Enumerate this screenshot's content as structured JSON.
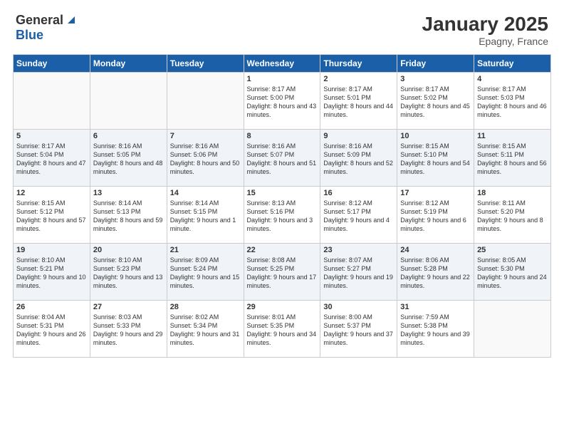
{
  "header": {
    "logo_general": "General",
    "logo_blue": "Blue",
    "month_year": "January 2025",
    "location": "Epagny, France"
  },
  "weekdays": [
    "Sunday",
    "Monday",
    "Tuesday",
    "Wednesday",
    "Thursday",
    "Friday",
    "Saturday"
  ],
  "weeks": [
    [
      {
        "day": "",
        "sunrise": "",
        "sunset": "",
        "daylight": ""
      },
      {
        "day": "",
        "sunrise": "",
        "sunset": "",
        "daylight": ""
      },
      {
        "day": "",
        "sunrise": "",
        "sunset": "",
        "daylight": ""
      },
      {
        "day": "1",
        "sunrise": "Sunrise: 8:17 AM",
        "sunset": "Sunset: 5:00 PM",
        "daylight": "Daylight: 8 hours and 43 minutes."
      },
      {
        "day": "2",
        "sunrise": "Sunrise: 8:17 AM",
        "sunset": "Sunset: 5:01 PM",
        "daylight": "Daylight: 8 hours and 44 minutes."
      },
      {
        "day": "3",
        "sunrise": "Sunrise: 8:17 AM",
        "sunset": "Sunset: 5:02 PM",
        "daylight": "Daylight: 8 hours and 45 minutes."
      },
      {
        "day": "4",
        "sunrise": "Sunrise: 8:17 AM",
        "sunset": "Sunset: 5:03 PM",
        "daylight": "Daylight: 8 hours and 46 minutes."
      }
    ],
    [
      {
        "day": "5",
        "sunrise": "Sunrise: 8:17 AM",
        "sunset": "Sunset: 5:04 PM",
        "daylight": "Daylight: 8 hours and 47 minutes."
      },
      {
        "day": "6",
        "sunrise": "Sunrise: 8:16 AM",
        "sunset": "Sunset: 5:05 PM",
        "daylight": "Daylight: 8 hours and 48 minutes."
      },
      {
        "day": "7",
        "sunrise": "Sunrise: 8:16 AM",
        "sunset": "Sunset: 5:06 PM",
        "daylight": "Daylight: 8 hours and 50 minutes."
      },
      {
        "day": "8",
        "sunrise": "Sunrise: 8:16 AM",
        "sunset": "Sunset: 5:07 PM",
        "daylight": "Daylight: 8 hours and 51 minutes."
      },
      {
        "day": "9",
        "sunrise": "Sunrise: 8:16 AM",
        "sunset": "Sunset: 5:09 PM",
        "daylight": "Daylight: 8 hours and 52 minutes."
      },
      {
        "day": "10",
        "sunrise": "Sunrise: 8:15 AM",
        "sunset": "Sunset: 5:10 PM",
        "daylight": "Daylight: 8 hours and 54 minutes."
      },
      {
        "day": "11",
        "sunrise": "Sunrise: 8:15 AM",
        "sunset": "Sunset: 5:11 PM",
        "daylight": "Daylight: 8 hours and 56 minutes."
      }
    ],
    [
      {
        "day": "12",
        "sunrise": "Sunrise: 8:15 AM",
        "sunset": "Sunset: 5:12 PM",
        "daylight": "Daylight: 8 hours and 57 minutes."
      },
      {
        "day": "13",
        "sunrise": "Sunrise: 8:14 AM",
        "sunset": "Sunset: 5:13 PM",
        "daylight": "Daylight: 8 hours and 59 minutes."
      },
      {
        "day": "14",
        "sunrise": "Sunrise: 8:14 AM",
        "sunset": "Sunset: 5:15 PM",
        "daylight": "Daylight: 9 hours and 1 minute."
      },
      {
        "day": "15",
        "sunrise": "Sunrise: 8:13 AM",
        "sunset": "Sunset: 5:16 PM",
        "daylight": "Daylight: 9 hours and 3 minutes."
      },
      {
        "day": "16",
        "sunrise": "Sunrise: 8:12 AM",
        "sunset": "Sunset: 5:17 PM",
        "daylight": "Daylight: 9 hours and 4 minutes."
      },
      {
        "day": "17",
        "sunrise": "Sunrise: 8:12 AM",
        "sunset": "Sunset: 5:19 PM",
        "daylight": "Daylight: 9 hours and 6 minutes."
      },
      {
        "day": "18",
        "sunrise": "Sunrise: 8:11 AM",
        "sunset": "Sunset: 5:20 PM",
        "daylight": "Daylight: 9 hours and 8 minutes."
      }
    ],
    [
      {
        "day": "19",
        "sunrise": "Sunrise: 8:10 AM",
        "sunset": "Sunset: 5:21 PM",
        "daylight": "Daylight: 9 hours and 10 minutes."
      },
      {
        "day": "20",
        "sunrise": "Sunrise: 8:10 AM",
        "sunset": "Sunset: 5:23 PM",
        "daylight": "Daylight: 9 hours and 13 minutes."
      },
      {
        "day": "21",
        "sunrise": "Sunrise: 8:09 AM",
        "sunset": "Sunset: 5:24 PM",
        "daylight": "Daylight: 9 hours and 15 minutes."
      },
      {
        "day": "22",
        "sunrise": "Sunrise: 8:08 AM",
        "sunset": "Sunset: 5:25 PM",
        "daylight": "Daylight: 9 hours and 17 minutes."
      },
      {
        "day": "23",
        "sunrise": "Sunrise: 8:07 AM",
        "sunset": "Sunset: 5:27 PM",
        "daylight": "Daylight: 9 hours and 19 minutes."
      },
      {
        "day": "24",
        "sunrise": "Sunrise: 8:06 AM",
        "sunset": "Sunset: 5:28 PM",
        "daylight": "Daylight: 9 hours and 22 minutes."
      },
      {
        "day": "25",
        "sunrise": "Sunrise: 8:05 AM",
        "sunset": "Sunset: 5:30 PM",
        "daylight": "Daylight: 9 hours and 24 minutes."
      }
    ],
    [
      {
        "day": "26",
        "sunrise": "Sunrise: 8:04 AM",
        "sunset": "Sunset: 5:31 PM",
        "daylight": "Daylight: 9 hours and 26 minutes."
      },
      {
        "day": "27",
        "sunrise": "Sunrise: 8:03 AM",
        "sunset": "Sunset: 5:33 PM",
        "daylight": "Daylight: 9 hours and 29 minutes."
      },
      {
        "day": "28",
        "sunrise": "Sunrise: 8:02 AM",
        "sunset": "Sunset: 5:34 PM",
        "daylight": "Daylight: 9 hours and 31 minutes."
      },
      {
        "day": "29",
        "sunrise": "Sunrise: 8:01 AM",
        "sunset": "Sunset: 5:35 PM",
        "daylight": "Daylight: 9 hours and 34 minutes."
      },
      {
        "day": "30",
        "sunrise": "Sunrise: 8:00 AM",
        "sunset": "Sunset: 5:37 PM",
        "daylight": "Daylight: 9 hours and 37 minutes."
      },
      {
        "day": "31",
        "sunrise": "Sunrise: 7:59 AM",
        "sunset": "Sunset: 5:38 PM",
        "daylight": "Daylight: 9 hours and 39 minutes."
      },
      {
        "day": "",
        "sunrise": "",
        "sunset": "",
        "daylight": ""
      }
    ]
  ]
}
